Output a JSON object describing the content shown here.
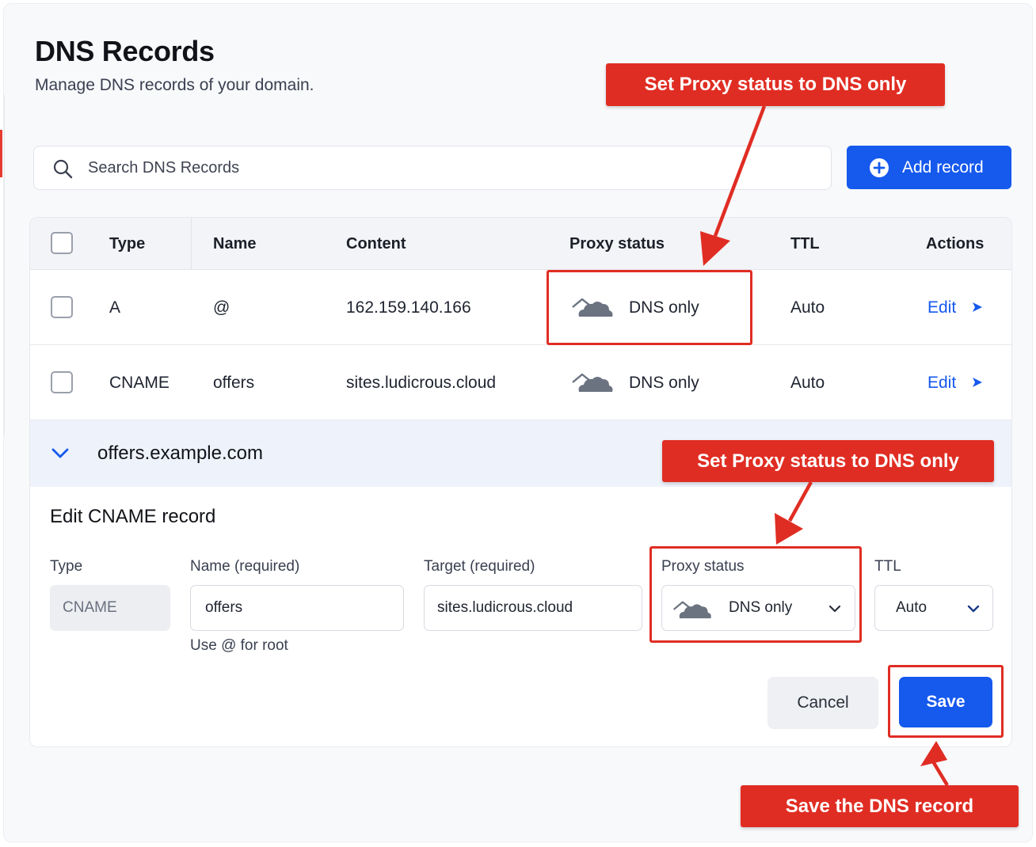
{
  "header": {
    "title": "DNS Records",
    "subtitle": "Manage DNS records of your domain."
  },
  "search": {
    "placeholder": "Search DNS Records",
    "value": ""
  },
  "toolbar": {
    "add_label": "Add record"
  },
  "table": {
    "columns": [
      "Type",
      "Name",
      "Content",
      "Proxy status",
      "TTL",
      "Actions"
    ],
    "rows": [
      {
        "type": "A",
        "name": "@",
        "content": "162.159.140.166",
        "proxy": "DNS only",
        "ttl": "Auto",
        "action": "Edit"
      },
      {
        "type": "CNAME",
        "name": "offers",
        "content": "sites.ludicrous.cloud",
        "proxy": "DNS only",
        "ttl": "Auto",
        "action": "Edit"
      }
    ]
  },
  "expanded": {
    "host": "offers.example.com"
  },
  "edit_form": {
    "title": "Edit CNAME record",
    "type_label": "Type",
    "type_value": "CNAME",
    "name_label": "Name (required)",
    "name_value": "offers",
    "name_hint": "Use @ for root",
    "target_label": "Target (required)",
    "target_value": "sites.ludicrous.cloud",
    "proxy_label": "Proxy status",
    "proxy_value": "DNS only",
    "ttl_label": "TTL",
    "ttl_value": "Auto",
    "cancel_label": "Cancel",
    "save_label": "Save"
  },
  "annotations": {
    "callout_1": "Set Proxy status to DNS only",
    "callout_2": "Set Proxy status to DNS only",
    "callout_3": "Save the DNS record"
  },
  "colors": {
    "primary": "#1559ed",
    "annotation": "#e02d23",
    "cloud_gray": "#6b7280"
  },
  "icons": {
    "search": "search-icon",
    "add": "plus-circle-icon",
    "proxy": "cloud-icon",
    "edit_arrow": "arrow-right-icon",
    "expand": "chevron-down-icon",
    "dropdown": "chevron-down-icon"
  }
}
